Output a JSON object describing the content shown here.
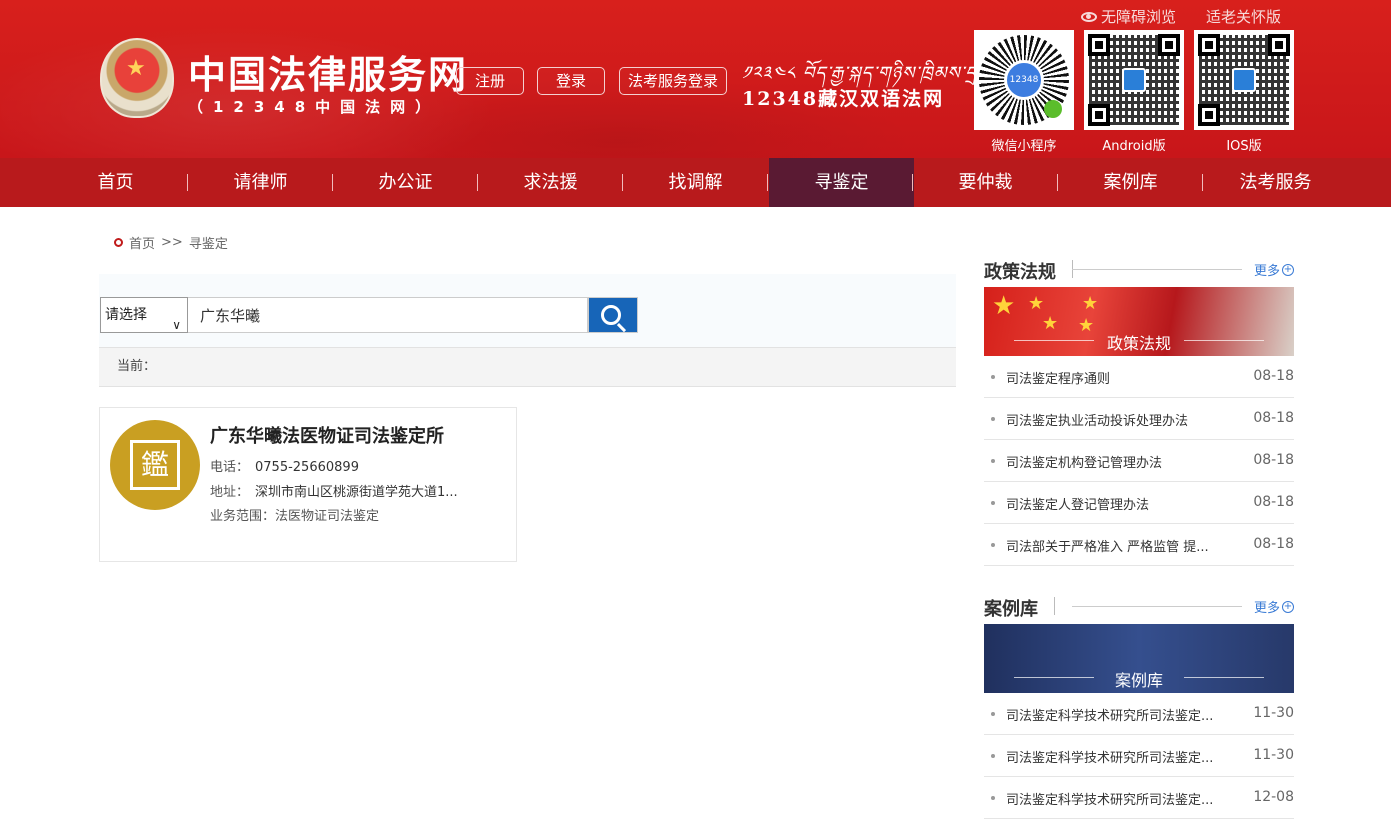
{
  "header": {
    "top_links": [
      "无障碍浏览",
      "适老关怀版"
    ],
    "site_title": "中国法律服务网",
    "site_subtitle": "（12348中国法网）",
    "register_label": "注册",
    "login_label": "登录",
    "exam_login_label": "法考服务登录",
    "tibetan_text": "༡༢༣༤༨ བོད་རྒྱ་སྐད་གཉིས་ཁྲིམས་དྲ།",
    "bilingual_title": "12348藏汉双语法网",
    "qr_labels": [
      "微信小程序",
      "Android版",
      "IOS版"
    ],
    "wx_center_text": "12348"
  },
  "nav": {
    "items": [
      "首页",
      "请律师",
      "办公证",
      "求法援",
      "找调解",
      "寻鉴定",
      "要仲裁",
      "案例库",
      "法考服务"
    ],
    "active_index": 5
  },
  "breadcrumb": {
    "home": "首页",
    "sep": ">>",
    "current": "寻鉴定"
  },
  "search": {
    "select_value": "请选择",
    "query": "广东华曦"
  },
  "current_label": "当前：",
  "result": {
    "name": "广东华曦法医物证司法鉴定所",
    "logo_glyph": "鑑",
    "phone_label": "电话：",
    "phone": "0755-25660899",
    "addr_label": "地址：",
    "addr": "深圳市南山区桃源街道学苑大道1...",
    "scope": "业务范围：法医物证司法鉴定"
  },
  "sidebar": {
    "more_label": "更多",
    "policy": {
      "title": "政策法规",
      "banner": "政策法规",
      "items": [
        {
          "text": "司法鉴定程序通则",
          "date": "08-18"
        },
        {
          "text": "司法鉴定执业活动投诉处理办法",
          "date": "08-18"
        },
        {
          "text": "司法鉴定机构登记管理办法",
          "date": "08-18"
        },
        {
          "text": "司法鉴定人登记管理办法",
          "date": "08-18"
        },
        {
          "text": "司法部关于严格准入 严格监管 提...",
          "date": "08-18"
        }
      ]
    },
    "cases": {
      "title": "案例库",
      "banner": "案例库",
      "items": [
        {
          "text": "司法鉴定科学技术研究所司法鉴定...",
          "date": "11-30"
        },
        {
          "text": "司法鉴定科学技术研究所司法鉴定...",
          "date": "11-30"
        },
        {
          "text": "司法鉴定科学技术研究所司法鉴定...",
          "date": "12-08"
        }
      ]
    }
  },
  "colors": {
    "header_red": "#d11a1c",
    "nav_red": "#b81a1c",
    "nav_active": "#5a1a33",
    "search_blue": "#1765b8",
    "link_blue": "#3a7bd5"
  }
}
